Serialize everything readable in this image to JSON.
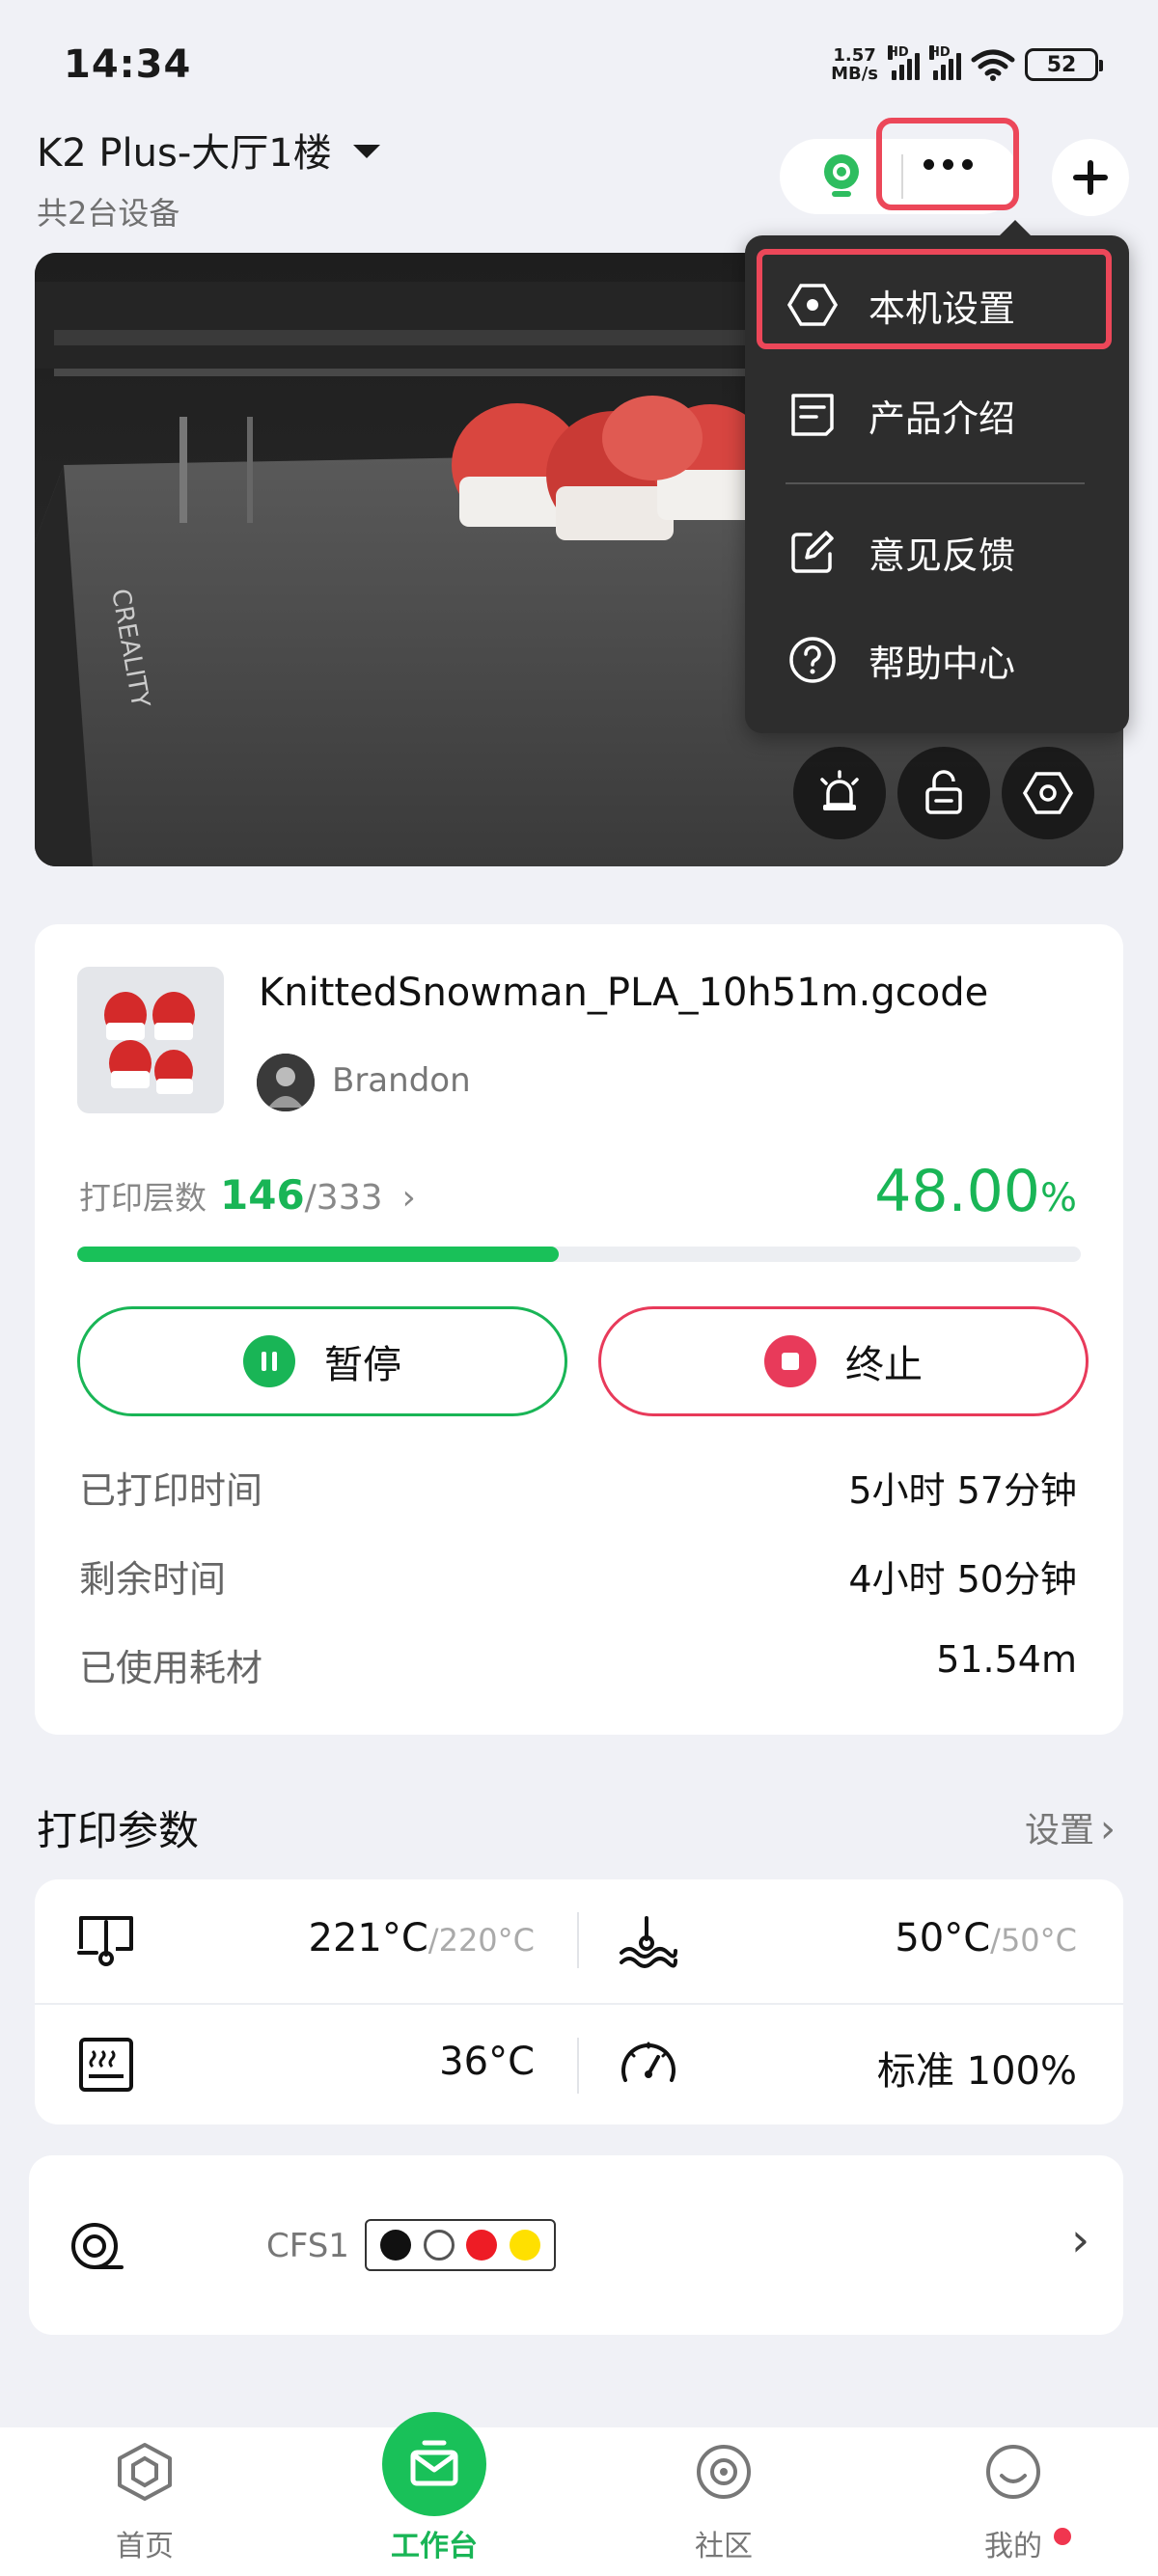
{
  "status_bar": {
    "time": "14:34",
    "net_speed_value": "1.57",
    "net_speed_unit": "MB/s",
    "hd1": "HD",
    "hd2": "HD",
    "battery": "52"
  },
  "header": {
    "device_title": "K2 Plus-大厅1楼",
    "device_count": "共2台设备"
  },
  "menu": {
    "items": [
      {
        "label": "本机设置",
        "icon": "settings-hex-icon"
      },
      {
        "label": "产品介绍",
        "icon": "product-intro-icon"
      },
      {
        "label": "意见反馈",
        "icon": "edit-feedback-icon"
      },
      {
        "label": "帮助中心",
        "icon": "help-icon"
      }
    ]
  },
  "camera": {
    "controls": [
      "light-icon",
      "unlock-icon",
      "settings-hex-icon"
    ]
  },
  "print_job": {
    "filename": "KnittedSnowman_PLA_10h51m.gcode",
    "author": "Brandon",
    "layers_label": "打印层数",
    "layer_current": "146",
    "layer_total": "/333",
    "percent_value": "48.00",
    "percent_sign": "%",
    "progress": 0.48,
    "pause_label": "暂停",
    "stop_label": "终止",
    "stats": [
      {
        "label": "已打印时间",
        "value": "5小时 57分钟"
      },
      {
        "label": "剩余时间",
        "value": "4小时 50分钟"
      },
      {
        "label": "已使用耗材",
        "value": "51.54m"
      }
    ]
  },
  "params": {
    "title": "打印参数",
    "settings_link": "设置",
    "nozzle_temp": "221°C",
    "nozzle_target": "/220°C",
    "bed_temp": "50°C",
    "bed_target": "/50°C",
    "chamber_temp": "36°C",
    "speed": "标准 100%"
  },
  "cfs": {
    "label": "CFS1",
    "slots": [
      "#111111",
      "#ffffff",
      "#ee1c25",
      "#ffe000"
    ]
  },
  "tabs": [
    {
      "label": "首页",
      "icon": "home-cube-icon"
    },
    {
      "label": "工作台",
      "icon": "workbench-icon"
    },
    {
      "label": "社区",
      "icon": "community-icon"
    },
    {
      "label": "我的",
      "icon": "profile-smile-icon"
    }
  ],
  "colors": {
    "accent": "#19b556",
    "stop": "#e83a5a",
    "highlight": "#ec4759"
  }
}
